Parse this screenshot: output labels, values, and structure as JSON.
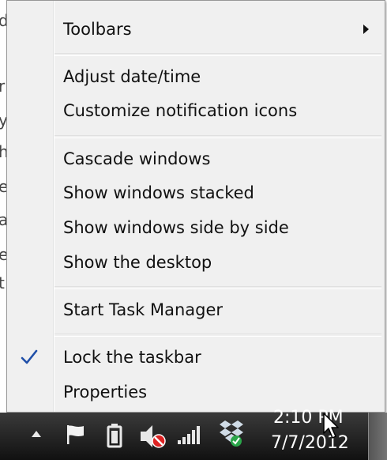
{
  "background_window": {
    "fragments": [
      "d",
      "r",
      "y",
      "h",
      "e",
      "a",
      "e",
      "t"
    ]
  },
  "menu": {
    "items": [
      {
        "label": "Toolbars",
        "submenu": true
      },
      {
        "label": "Adjust date/time"
      },
      {
        "label": "Customize notification icons"
      },
      {
        "label": "Cascade windows"
      },
      {
        "label": "Show windows stacked"
      },
      {
        "label": "Show windows side by side"
      },
      {
        "label": "Show the desktop"
      },
      {
        "label": "Start Task Manager"
      },
      {
        "label": "Lock the taskbar",
        "checked": true
      },
      {
        "label": "Properties"
      }
    ]
  },
  "taskbar": {
    "tray_icons": [
      "show-hidden-icons-arrow",
      "action-center-flag-icon",
      "battery-icon",
      "volume-muted-icon",
      "network-signal-icon",
      "dropbox-icon"
    ],
    "clock": {
      "time": "2:10 PM",
      "date": "7/7/2012"
    }
  },
  "colors": {
    "menu_bg": "#f0f0f0",
    "menu_border": "#979797",
    "check": "#1f4fa8",
    "taskbar": "#1a1a1a"
  }
}
